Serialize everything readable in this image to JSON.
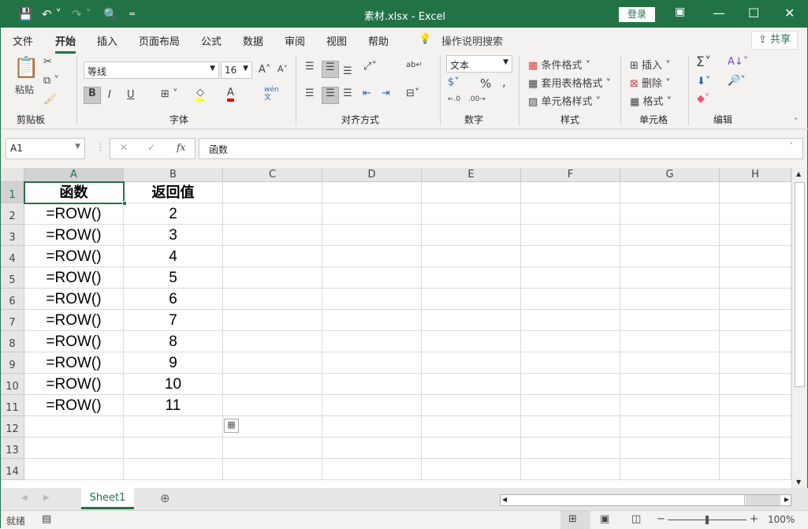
{
  "title": {
    "text": "素材.xlsx  -  Excel",
    "login": "登录",
    "qa_more": "="
  },
  "tabs": [
    "文件",
    "开始",
    "插入",
    "页面布局",
    "公式",
    "数据",
    "审阅",
    "视图",
    "帮助"
  ],
  "search": "操作说明搜索",
  "share": "共享",
  "ribbon": {
    "paste": "粘贴",
    "font_name": "等线",
    "font_size": "16",
    "number_format": "文本",
    "groups": [
      "剪贴板",
      "字体",
      "对齐方式",
      "数字",
      "样式",
      "单元格",
      "编辑"
    ],
    "styles": [
      "条件格式",
      "套用表格格式",
      "单元格样式"
    ],
    "cells": [
      "插入",
      "删除",
      "格式"
    ],
    "bold": "B",
    "italic": "I",
    "underline": "U",
    "phonetic_top": "wén",
    "phonetic_bottom": "文"
  },
  "formula": {
    "name_box": "A1",
    "fx": "fx",
    "content": "函数"
  },
  "grid": {
    "columns": [
      "A",
      "B",
      "C",
      "D",
      "E",
      "F",
      "G",
      "H"
    ],
    "rows": [
      "1",
      "2",
      "3",
      "4",
      "5",
      "6",
      "7",
      "8",
      "9",
      "10",
      "11",
      "12",
      "13",
      "14"
    ],
    "cells": [
      [
        "函数",
        "返回值"
      ],
      [
        "=ROW()",
        "2"
      ],
      [
        "=ROW()",
        "3"
      ],
      [
        "=ROW()",
        "4"
      ],
      [
        "=ROW()",
        "5"
      ],
      [
        "=ROW()",
        "6"
      ],
      [
        "=ROW()",
        "7"
      ],
      [
        "=ROW()",
        "8"
      ],
      [
        "=ROW()",
        "9"
      ],
      [
        "=ROW()",
        "10"
      ],
      [
        "=ROW()",
        "11"
      ]
    ]
  },
  "sheet": {
    "tab": "Sheet1"
  },
  "status": {
    "ready": "就绪",
    "zoom": "100%"
  },
  "colors": {
    "accent": "#217346"
  }
}
